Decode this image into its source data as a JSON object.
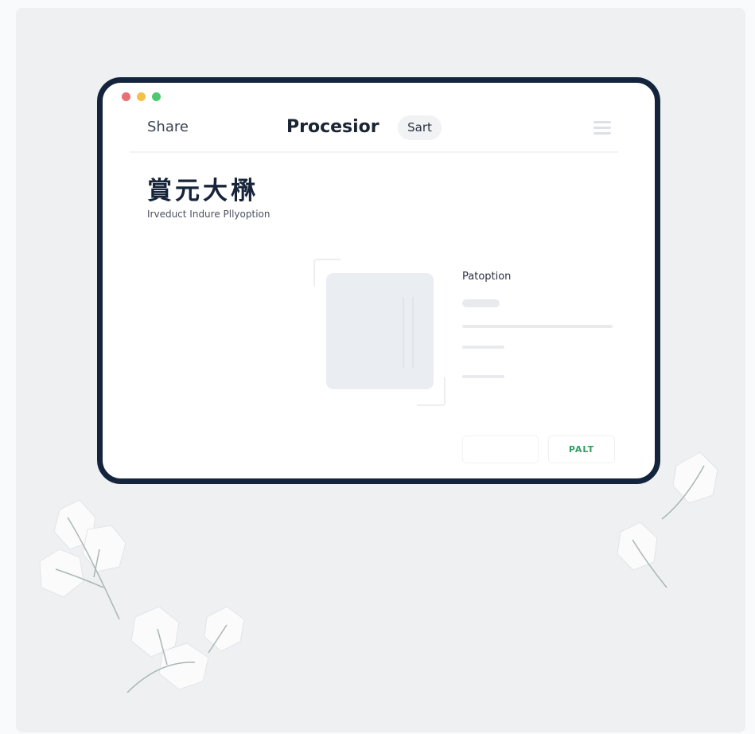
{
  "window": {
    "controls": [
      "close",
      "minimize",
      "maximize"
    ],
    "colors": {
      "close": "#e86f72",
      "minimize": "#f2c04b",
      "maximize": "#4cc86f"
    }
  },
  "header": {
    "share_label": "Share",
    "title": "Procesior",
    "sart_label": "Sart",
    "menu_icon": "hamburger-menu-icon"
  },
  "hero": {
    "headline": "賞元大㮊",
    "subline": "Irveduct Indure Pllyoption"
  },
  "panel": {
    "label": "Patoption",
    "image_icon": "image-placeholder"
  },
  "footer": {
    "cancel_label": "",
    "palt_label": "PALT"
  },
  "theme": {
    "frame": "#15243d",
    "accent": "#2f9e60",
    "background": "#eef0f2"
  }
}
